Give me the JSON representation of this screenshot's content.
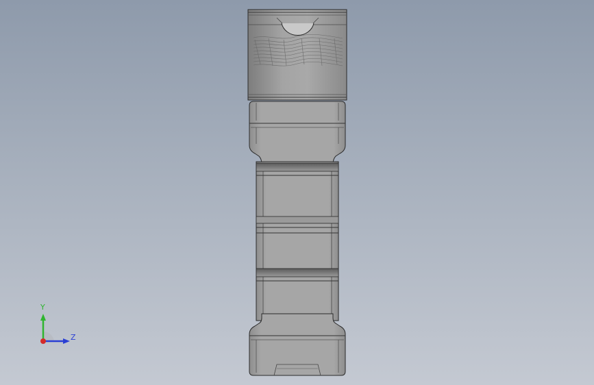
{
  "viewport": {
    "background_top": "#8e9aab",
    "background_bottom": "#c4c9d2"
  },
  "model": {
    "body_color": "#a7a7a7",
    "cap_color": "#9c9c9c",
    "edge_color": "#2a2a2a"
  },
  "triad": {
    "y_label": "Y",
    "z_label": "Z",
    "y_color": "#2fb52f",
    "z_color": "#2a3fd4",
    "x_color": "#d42a2a"
  }
}
